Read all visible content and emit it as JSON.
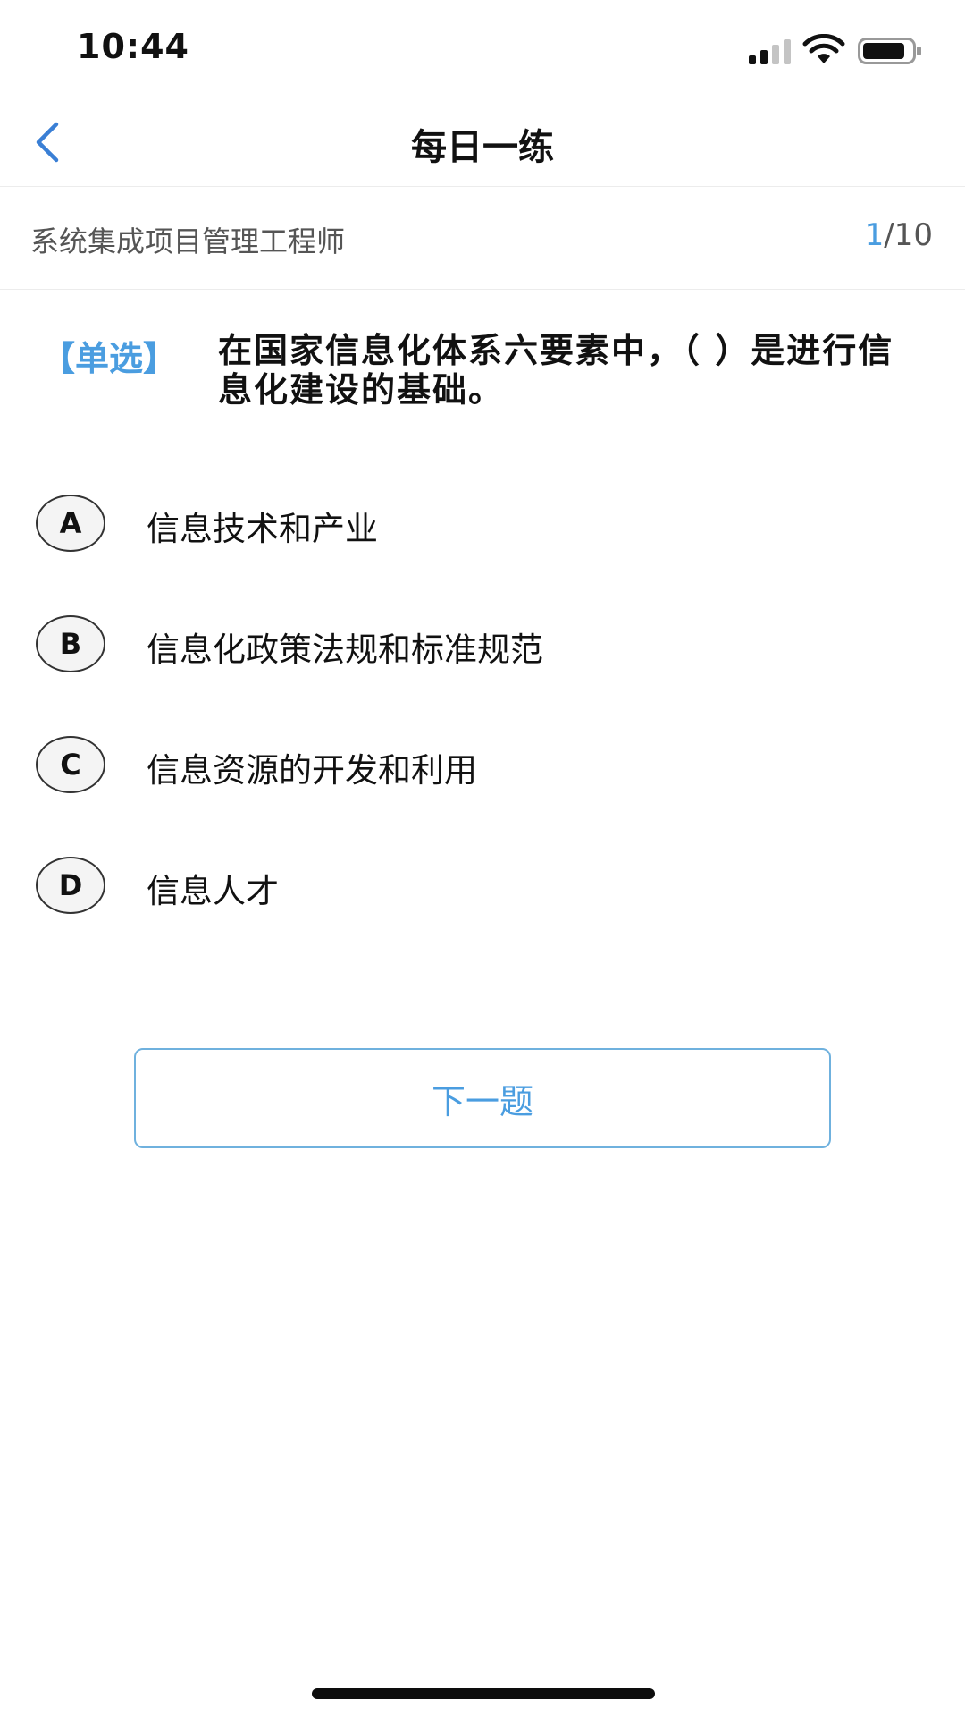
{
  "status_bar": {
    "time": "10:44",
    "signal_icon": "cellular-signal-icon",
    "wifi_icon": "wifi-icon",
    "battery_icon": "battery-icon"
  },
  "nav": {
    "back_icon": "chevron-left-icon",
    "title": "每日一练"
  },
  "sub_header": {
    "exam_name": "系统集成项目管理工程师",
    "progress_current": "1",
    "progress_total": "/10"
  },
  "question": {
    "type_label": "【单选】",
    "text": "在国家信息化体系六要素中，（  ）是进行信息化建设的基础。"
  },
  "options": [
    {
      "letter": "A",
      "text": "信息技术和产业"
    },
    {
      "letter": "B",
      "text": "信息化政策法规和标准规范"
    },
    {
      "letter": "C",
      "text": "信息资源的开发和利用"
    },
    {
      "letter": "D",
      "text": "信息人才"
    }
  ],
  "next_button": {
    "label": "下一题"
  },
  "colors": {
    "accent": "#4a9de0",
    "button_border": "#6fb1de",
    "text": "#111111",
    "muted": "#555555"
  }
}
